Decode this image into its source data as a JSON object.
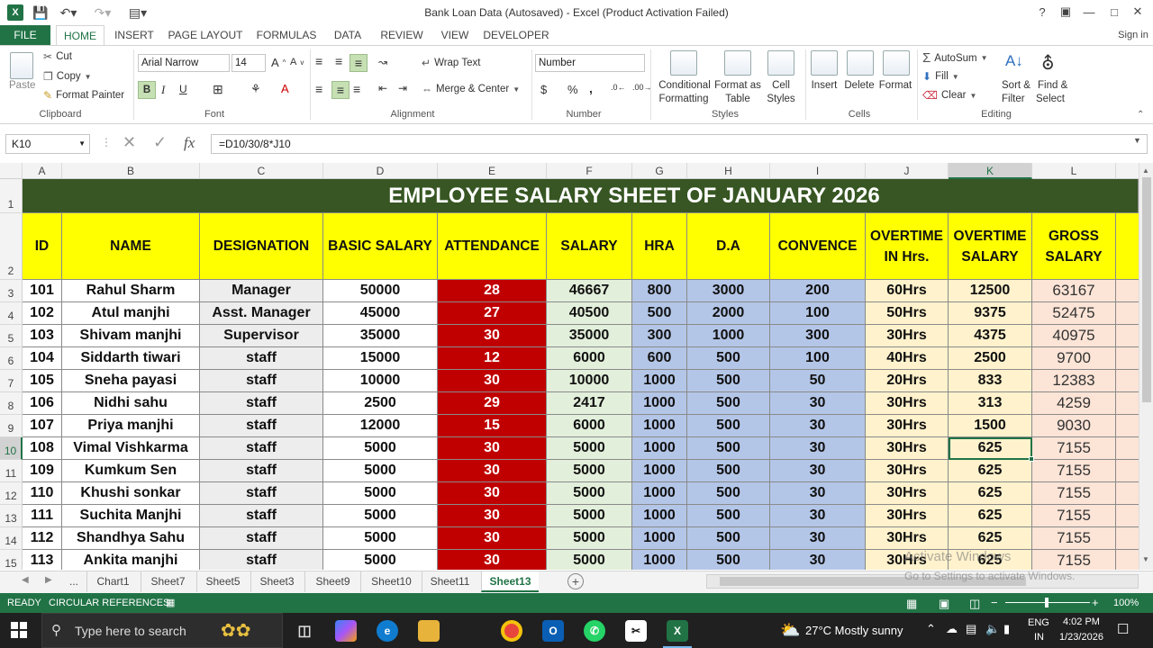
{
  "window": {
    "title": "Bank Loan Data (Autosaved) - Excel (Product Activation Failed)",
    "app_icon": "X",
    "help": "?",
    "signin": "Sign in"
  },
  "ribbon_tabs": [
    "FILE",
    "HOME",
    "INSERT",
    "PAGE LAYOUT",
    "FORMULAS",
    "DATA",
    "REVIEW",
    "VIEW",
    "DEVELOPER"
  ],
  "clipboard": {
    "paste": "Paste",
    "cut": "Cut",
    "copy": "Copy",
    "format_painter": "Format Painter",
    "label": "Clipboard"
  },
  "font": {
    "name": "Arial Narrow",
    "size": "14",
    "label": "Font",
    "bold": "B",
    "italic": "I",
    "underline": "U"
  },
  "alignment": {
    "wrap": "Wrap Text",
    "merge": "Merge & Center",
    "label": "Alignment"
  },
  "number": {
    "format": "Number",
    "label": "Number",
    "currency": "$",
    "percent": "%",
    "comma": ","
  },
  "styles": {
    "conditional": "Conditional",
    "formatting": "Formatting",
    "format_as": "Format as",
    "table": "Table",
    "cell": "Cell",
    "cell_styles": "Styles",
    "label": "Styles"
  },
  "cells": {
    "insert": "Insert",
    "delete": "Delete",
    "format": "Format",
    "label": "Cells"
  },
  "editing": {
    "autosum": "AutoSum",
    "fill": "Fill",
    "clear": "Clear",
    "sort": "Sort &",
    "filter": "Filter",
    "find": "Find &",
    "select": "Select",
    "label": "Editing"
  },
  "formula_bar": {
    "name_box": "K10",
    "fx": "fx",
    "formula": "=D10/30/8*J10"
  },
  "columns": [
    "A",
    "B",
    "C",
    "D",
    "E",
    "F",
    "G",
    "H",
    "I",
    "J",
    "K",
    "L"
  ],
  "sheet": {
    "title": "EMPLOYEE SALARY SHEET  OF JANUARY 2026",
    "headers": [
      "ID",
      "NAME",
      "DESIGNATION",
      "BASIC SALARY",
      "ATTENDANCE",
      "SALARY",
      "HRA",
      "D.A",
      "CONVENCE",
      "OVERTIME IN Hrs.",
      "OVERTIME SALARY",
      "GROSS SALARY"
    ],
    "row_numbers": [
      "1",
      "2",
      "3",
      "4",
      "5",
      "6",
      "7",
      "8",
      "9",
      "10",
      "11",
      "12",
      "13",
      "14",
      "15"
    ],
    "rows": [
      [
        "101",
        "Rahul Sharm",
        "Manager",
        "50000",
        "28",
        "46667",
        "800",
        "3000",
        "200",
        "60Hrs",
        "12500",
        "63167"
      ],
      [
        "102",
        "Atul manjhi",
        "Asst. Manager",
        "45000",
        "27",
        "40500",
        "500",
        "2000",
        "100",
        "50Hrs",
        "9375",
        "52475"
      ],
      [
        "103",
        "Shivam manjhi",
        "Supervisor",
        "35000",
        "30",
        "35000",
        "300",
        "1000",
        "300",
        "30Hrs",
        "4375",
        "40975"
      ],
      [
        "104",
        "Siddarth tiwari",
        "staff",
        "15000",
        "12",
        "6000",
        "600",
        "500",
        "100",
        "40Hrs",
        "2500",
        "9700"
      ],
      [
        "105",
        "Sneha payasi",
        "staff",
        "10000",
        "30",
        "10000",
        "1000",
        "500",
        "50",
        "20Hrs",
        "833",
        "12383"
      ],
      [
        "106",
        "Nidhi sahu",
        "staff",
        "2500",
        "29",
        "2417",
        "1000",
        "500",
        "30",
        "30Hrs",
        "313",
        "4259"
      ],
      [
        "107",
        "Priya manjhi",
        "staff",
        "12000",
        "15",
        "6000",
        "1000",
        "500",
        "30",
        "30Hrs",
        "1500",
        "9030"
      ],
      [
        "108",
        "Vimal Vishkarma",
        "staff",
        "5000",
        "30",
        "5000",
        "1000",
        "500",
        "30",
        "30Hrs",
        "625",
        "7155"
      ],
      [
        "109",
        "Kumkum Sen",
        "staff",
        "5000",
        "30",
        "5000",
        "1000",
        "500",
        "30",
        "30Hrs",
        "625",
        "7155"
      ],
      [
        "110",
        "Khushi sonkar",
        "staff",
        "5000",
        "30",
        "5000",
        "1000",
        "500",
        "30",
        "30Hrs",
        "625",
        "7155"
      ],
      [
        "111",
        "Suchita Manjhi",
        "staff",
        "5000",
        "30",
        "5000",
        "1000",
        "500",
        "30",
        "30Hrs",
        "625",
        "7155"
      ],
      [
        "112",
        "Shandhya Sahu",
        "staff",
        "5000",
        "30",
        "5000",
        "1000",
        "500",
        "30",
        "30Hrs",
        "625",
        "7155"
      ],
      [
        "113",
        "Ankita manjhi",
        "staff",
        "5000",
        "30",
        "5000",
        "1000",
        "500",
        "30",
        "30Hrs",
        "625",
        "7155"
      ]
    ]
  },
  "sheet_tabs": [
    "...",
    "Chart1",
    "Sheet7",
    "Sheet5",
    "Sheet3",
    "Sheet9",
    "Sheet10",
    "Sheet11",
    "Sheet13"
  ],
  "active_sheet": "Sheet13",
  "status": {
    "ready": "READY",
    "circular": "CIRCULAR REFERENCES",
    "zoom": "100%"
  },
  "watermark": {
    "line1": "Activate Windows",
    "line2": "Go to Settings to activate Windows."
  },
  "taskbar": {
    "search": "Type here to search",
    "weather": "27°C  Mostly sunny",
    "lang1": "ENG",
    "lang2": "IN",
    "time": "4:02 PM",
    "date": "1/23/2026"
  },
  "colors": {
    "excel_green": "#217346",
    "title_fill": "#375623",
    "header_fill": "#ffff00",
    "attendance_fill": "#c00000",
    "salary_fill": "#e2efda",
    "blue_fill": "#b4c6e7",
    "overtime_fill": "#fff2cc",
    "gross_fill": "#fce4d6",
    "gray_fill": "#ededed"
  }
}
